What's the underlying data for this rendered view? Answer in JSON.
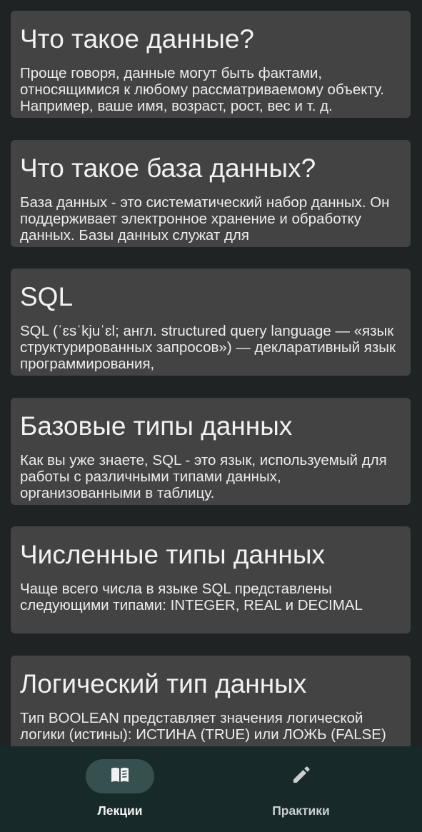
{
  "cards": [
    {
      "title": "Что такое данные?",
      "text": "Проще говоря, данные могут быть фактами, относящимися к любому рассматриваемому объекту. Например, ваше имя, возраст, рост, вес и т. д."
    },
    {
      "title": "Что такое база данных?",
      "text": "База данных - это систематический набор данных. Он поддерживает электронное хранение и обработку данных. Базы данных служат для"
    },
    {
      "title": "SQL",
      "text": "SQL (ˈɛsˈkjuˈɛl; англ. structured query language — «язык структурированных запросов») — декларативный язык программирования,"
    },
    {
      "title": "Базовые типы данных",
      "text": "Как вы уже знаете, SQL - это язык, используемый для работы с различными типами данных, организованными в таблицу."
    },
    {
      "title": "Численные типы данных",
      "text": "Чаще всего числа в языке SQL представлены следующими типами: INTEGER, REAL и DECIMAL"
    },
    {
      "title": "Логический тип данных",
      "text": "Тип BOOLEAN представляет значения логической логики (истины): ИСТИНА (TRUE) или ЛОЖЬ (FALSE)"
    }
  ],
  "nav": {
    "lectures_label": "Лекции",
    "lectures_icon": "book-open-icon",
    "practice_label": "Практики",
    "practice_icon": "pencil-icon",
    "active_color": "#35504f"
  }
}
